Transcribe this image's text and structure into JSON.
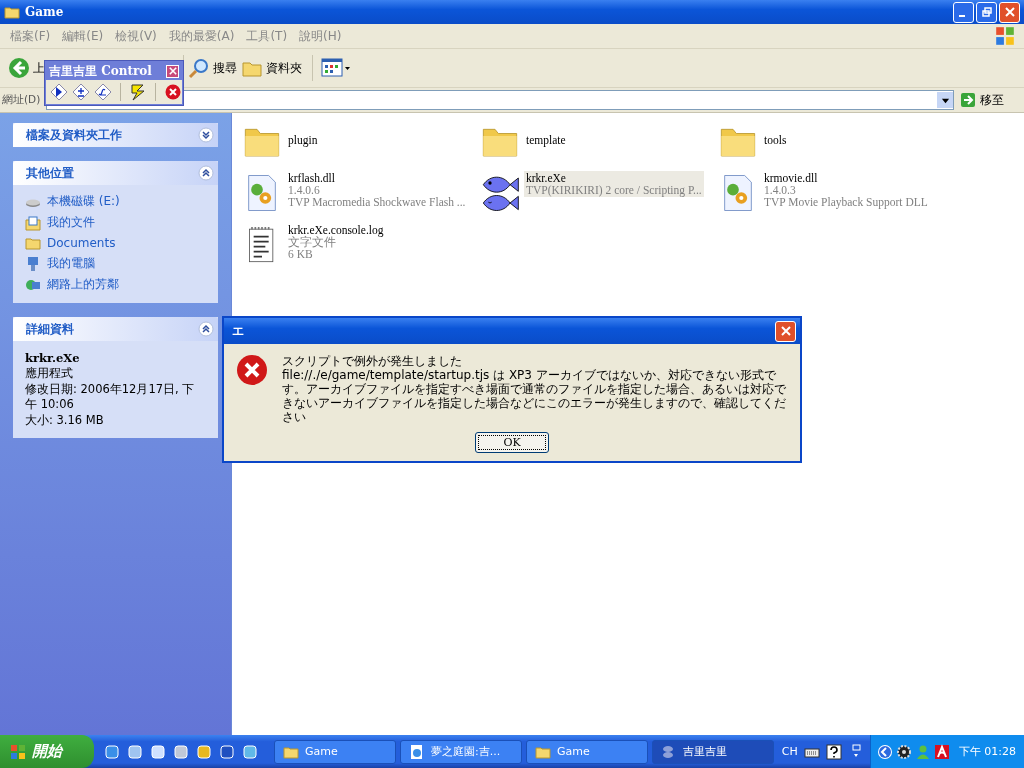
{
  "window": {
    "title": "Game"
  },
  "menu": [
    "檔案(F)",
    "編輯(E)",
    "檢視(V)",
    "我的最愛(A)",
    "工具(T)",
    "說明(H)"
  ],
  "toolbar": [
    {
      "kind": "back",
      "label": "上"
    },
    {
      "kind": "search",
      "label": "搜尋"
    },
    {
      "kind": "folders",
      "label": "資料夾"
    },
    {
      "kind": "views"
    }
  ],
  "address": {
    "label": "網址(D)",
    "go": "移至"
  },
  "panels": [
    {
      "title": "檔案及資料夾工作",
      "expanded": false
    },
    {
      "title": "其他位置",
      "expanded": true,
      "items": [
        {
          "kind": "drive",
          "label": "本機磁碟 (E:)"
        },
        {
          "kind": "mydocs",
          "label": "我的文件"
        },
        {
          "kind": "folder",
          "label": "Documents"
        },
        {
          "kind": "computer",
          "label": "我的電腦"
        },
        {
          "kind": "network",
          "label": "網路上的芳鄰"
        }
      ]
    },
    {
      "title": "詳細資料",
      "expanded": true,
      "details": {
        "name": "krkr.eXe",
        "type": "應用程式",
        "lines": [
          "修改日期: 2006年12月17日, 下午 10:06",
          "大小: 3.16 MB"
        ]
      }
    }
  ],
  "files": [
    {
      "kind": "folder",
      "name": "plugin",
      "selected": false
    },
    {
      "kind": "folder",
      "name": "template",
      "selected": false
    },
    {
      "kind": "folder",
      "name": "tools",
      "selected": false
    },
    {
      "kind": "dll",
      "name": "krflash.dll",
      "lines": [
        "1.4.0.6",
        "TVP Macromedia Shockwave Flash ..."
      ],
      "selected": false
    },
    {
      "kind": "exe",
      "name": "krkr.eXe",
      "lines": [
        "TVP(KIRIKIRI) 2 core / Scripting P..."
      ],
      "selected": true
    },
    {
      "kind": "dll",
      "name": "krmovie.dll",
      "lines": [
        "1.4.0.3",
        "TVP Movie Playback Support DLL"
      ],
      "selected": false
    },
    {
      "kind": "log",
      "name": "krkr.eXe.console.log",
      "lines": [
        "文字文件",
        "6 KB"
      ],
      "selected": false
    }
  ],
  "control": {
    "title": "吉里吉里 Control",
    "buttons": [
      {
        "kind": "play"
      },
      {
        "kind": "step"
      },
      {
        "kind": "trace"
      },
      {
        "kind": "reload"
      },
      {
        "kind": "stop"
      }
    ]
  },
  "dialog": {
    "title": "エ",
    "heading": "スクリプトで例外が発生しました",
    "message": "file://./e/game/template/startup.tjs は XP3 アーカイブではないか、対応できない形式です。アーカイブファイルを指定すべき場面で通常のファイルを指定した場合、あるいは対応できないアーカイブファイルを指定した場合などにこのエラーが発生しますので、確認してください",
    "button": "OK"
  },
  "taskbar": {
    "start": "開始",
    "quick_launch": [
      {
        "kind": "ie"
      },
      {
        "kind": "desktop"
      },
      {
        "kind": "media"
      },
      {
        "kind": "calc"
      },
      {
        "kind": "app"
      },
      {
        "kind": "cpp"
      },
      {
        "kind": "network"
      }
    ],
    "tasks": [
      {
        "kind": "folder",
        "label": "Game",
        "selected": false
      },
      {
        "kind": "ie",
        "label": "夢之庭園:吉...",
        "selected": false
      },
      {
        "kind": "folder",
        "label": "Game",
        "selected": false
      },
      {
        "kind": "fish",
        "label": "吉里吉里",
        "selected": true
      }
    ],
    "language": "CH",
    "clock": "下午 01:28"
  }
}
